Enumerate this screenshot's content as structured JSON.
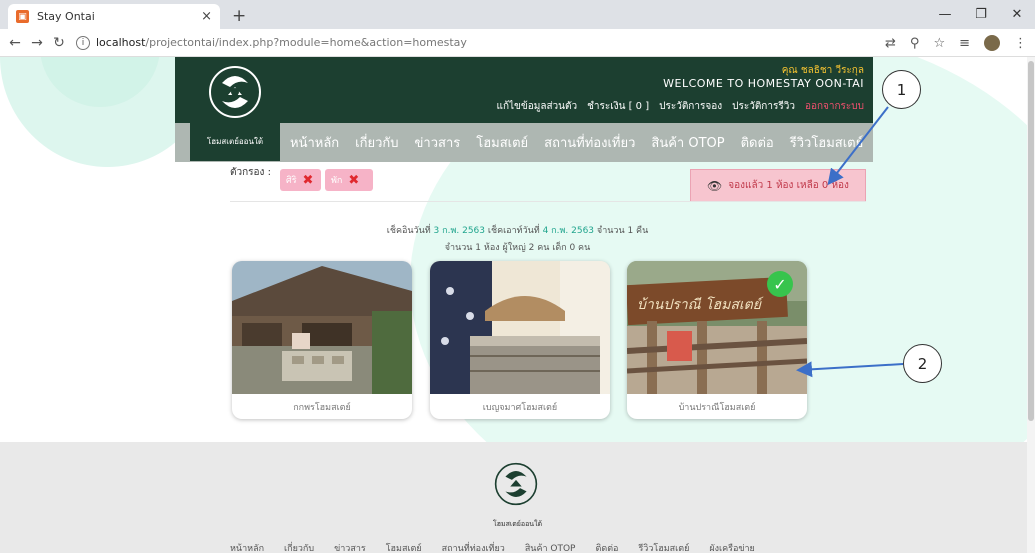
{
  "browser": {
    "tab_title": "Stay Ontai",
    "tab_close": "×",
    "new_tab": "+",
    "url_host": "localhost",
    "url_path": "/projectontai/index.php?module=home&action=homestay"
  },
  "header": {
    "logo_text": "โฮมสเตย์ออนใต้",
    "user_name": "คุณ ชลธิชา วีระกุล",
    "welcome": "WELCOME TO HOMESTAY OON-TAI",
    "top_links": {
      "edit_profile": "แก้ไขข้อมูลส่วนตัว",
      "payment": "ชำระเงิน [ 0 ]",
      "booking_history": "ประวัติการจอง",
      "review_history": "ประวัติการรีวิว",
      "logout": "ออกจากระบบ"
    },
    "nav": [
      "หน้าหลัก",
      "เกี่ยวกับ",
      "ข่าวสาร",
      "โฮมสเตย์",
      "สถานที่ท่องเที่ยว",
      "สินค้า OTOP",
      "ติดต่อ",
      "รีวิวโฮมสเตย์"
    ]
  },
  "filter": {
    "label": "ตัวกรอง :",
    "chips": [
      "ศิริ",
      "พัก"
    ],
    "booked_status": "จองแล้ว 1 ห้อง เหลือ 0 ห้อง"
  },
  "search_info": {
    "checkin_label": "เช็คอินวันที่",
    "checkin_date": "3 ก.พ. 2563",
    "checkout_label": "เช็คเอาท์วันที่",
    "checkout_date": "4 ก.พ. 2563",
    "nights": "จำนวน 1 คืน",
    "line2": "จำนวน 1 ห้อง ผู้ใหญ่ 2 คน เด็ก 0 คน"
  },
  "homestays": [
    {
      "name": "กกพรโฮมสเตย์",
      "selected": false
    },
    {
      "name": "เบญจมาศโฮมสเตย์",
      "selected": false
    },
    {
      "name": "บ้านปราณีโฮมสเตย์",
      "selected": true,
      "sign_text": "บ้านปราณี โฮมสเตย์"
    }
  ],
  "footer": {
    "logo_text": "โฮมสเตย์ออนใต้",
    "nav": [
      "หน้าหลัก",
      "เกี่ยวกับ",
      "ข่าวสาร",
      "โฮมสเตย์",
      "สถานที่ท่องเที่ยว",
      "สินค้า OTOP",
      "ติดต่อ",
      "รีวิวโฮมสเตย์",
      "ผังเครือข่าย"
    ]
  },
  "annotations": {
    "callout1": "1",
    "callout2": "2"
  },
  "colors": {
    "header_dark": "#1c3f30",
    "nav_bar": "#aeb7b2",
    "accent_mint": "#ddf6ee",
    "chip_pink": "#f6b3c7",
    "logout_red": "#f0506e"
  }
}
